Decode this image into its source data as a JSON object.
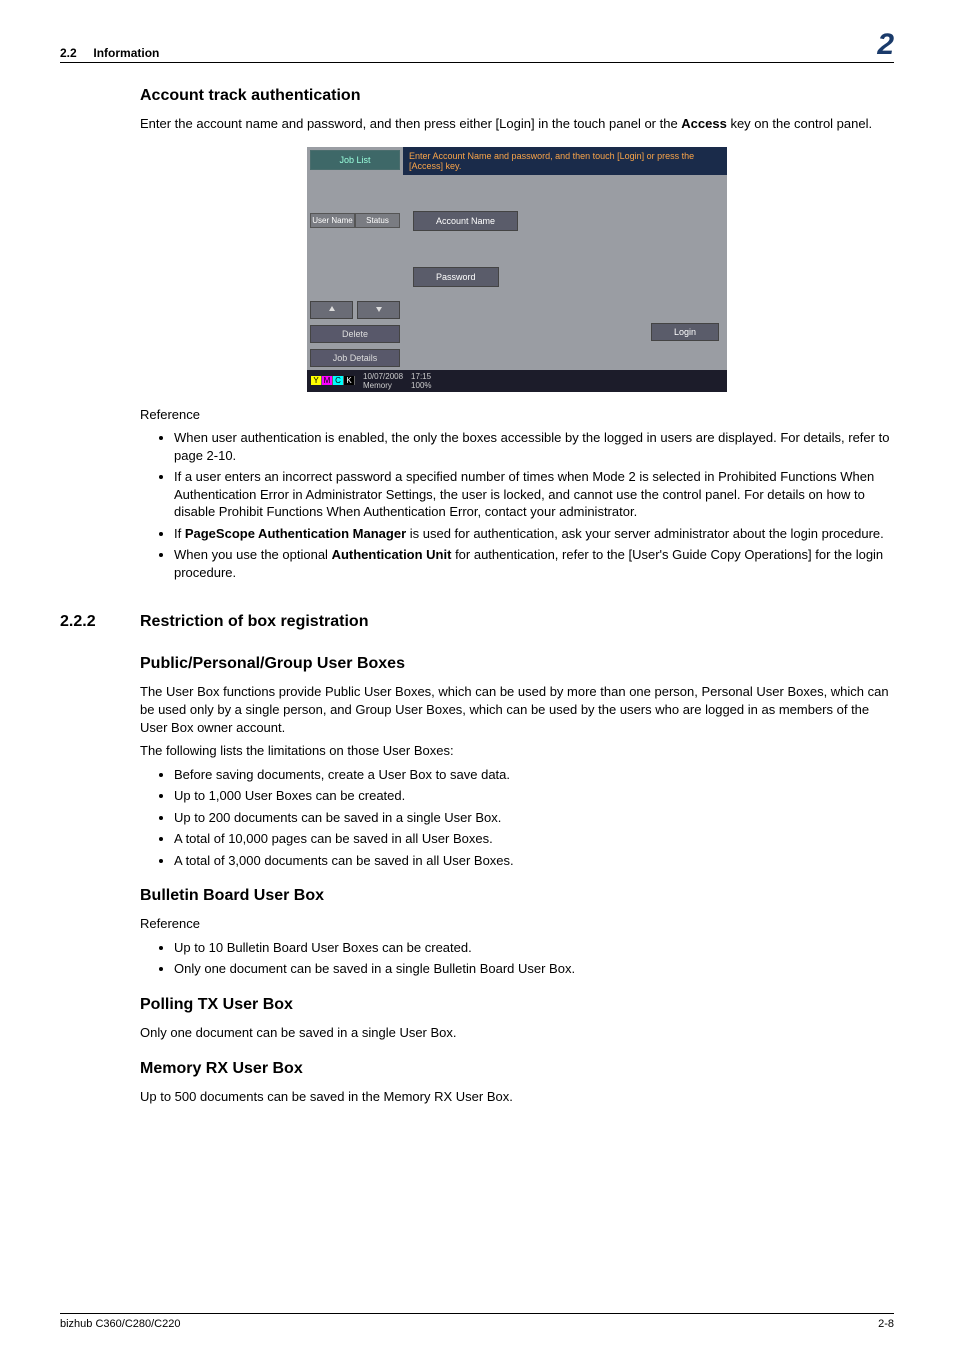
{
  "header": {
    "section_num": "2.2",
    "section_title": "Information",
    "chapter_num": "2"
  },
  "s1": {
    "heading": "Account track authentication",
    "intro_pre": "Enter the account name and password, and then press either [Login] in the touch panel or the ",
    "intro_bold": "Access",
    "intro_post": " key on the control panel."
  },
  "ui": {
    "job_list": "Job List",
    "prompt": "Enter Account Name and password, and then touch [Login] or press the [Access] key.",
    "user_name_tab": "User Name",
    "status_tab": "Status",
    "account_name": "Account Name",
    "password": "Password",
    "delete": "Delete",
    "job_details": "Job Details",
    "login": "Login",
    "date": "10/07/2008",
    "time": "17:15",
    "memory": "Memory",
    "memory_pct": "100%",
    "y": "Y",
    "m": "M",
    "c": "C",
    "k": "K"
  },
  "ref1": {
    "label": "Reference",
    "b1": "When user authentication is enabled, the only the boxes accessible by the logged in users are displayed. For details, refer to page 2-10.",
    "b2": "If a user enters an incorrect password a specified number of times when Mode 2 is selected in Prohibited Functions When Authentication Error in Administrator Settings, the user is locked, and cannot use the control panel. For details on how to disable Prohibit Functions When Authentication Error, contact your administrator.",
    "b3_pre": "If ",
    "b3_bold": "PageScope Authentication Manager",
    "b3_post": " is used for authentication, ask your server administrator about the login procedure.",
    "b4_pre": "When you use the optional ",
    "b4_bold": "Authentication Unit",
    "b4_post": " for authentication, refer to the [User's Guide Copy Operations] for the login procedure."
  },
  "s2": {
    "num": "2.2.2",
    "title": "Restriction of box registration"
  },
  "pub": {
    "heading": "Public/Personal/Group User Boxes",
    "p1": "The User Box functions provide Public User Boxes, which can be used by more than one person, Personal User Boxes, which can be used only by a single person, and Group User Boxes, which can be used by the users who are logged in as members of the User Box owner account.",
    "p2": "The following lists the limitations on those User Boxes:",
    "b1": "Before saving documents, create a User Box to save data.",
    "b2": "Up to 1,000 User Boxes can be created.",
    "b3": "Up to 200 documents can be saved in a single User Box.",
    "b4": "A total of 10,000 pages can be saved in all User Boxes.",
    "b5": "A total of 3,000 documents can be saved in all User Boxes."
  },
  "bul": {
    "heading": "Bulletin Board User Box",
    "ref": "Reference",
    "b1": "Up to 10 Bulletin Board User Boxes can be created.",
    "b2": "Only one document can be saved in a single Bulletin Board User Box."
  },
  "poll": {
    "heading": "Polling TX User Box",
    "p": "Only one document can be saved in a single User Box."
  },
  "mem": {
    "heading": "Memory RX User Box",
    "p": "Up to 500 documents can be saved in the Memory RX User Box."
  },
  "footer": {
    "left": "bizhub C360/C280/C220",
    "right": "2-8"
  }
}
